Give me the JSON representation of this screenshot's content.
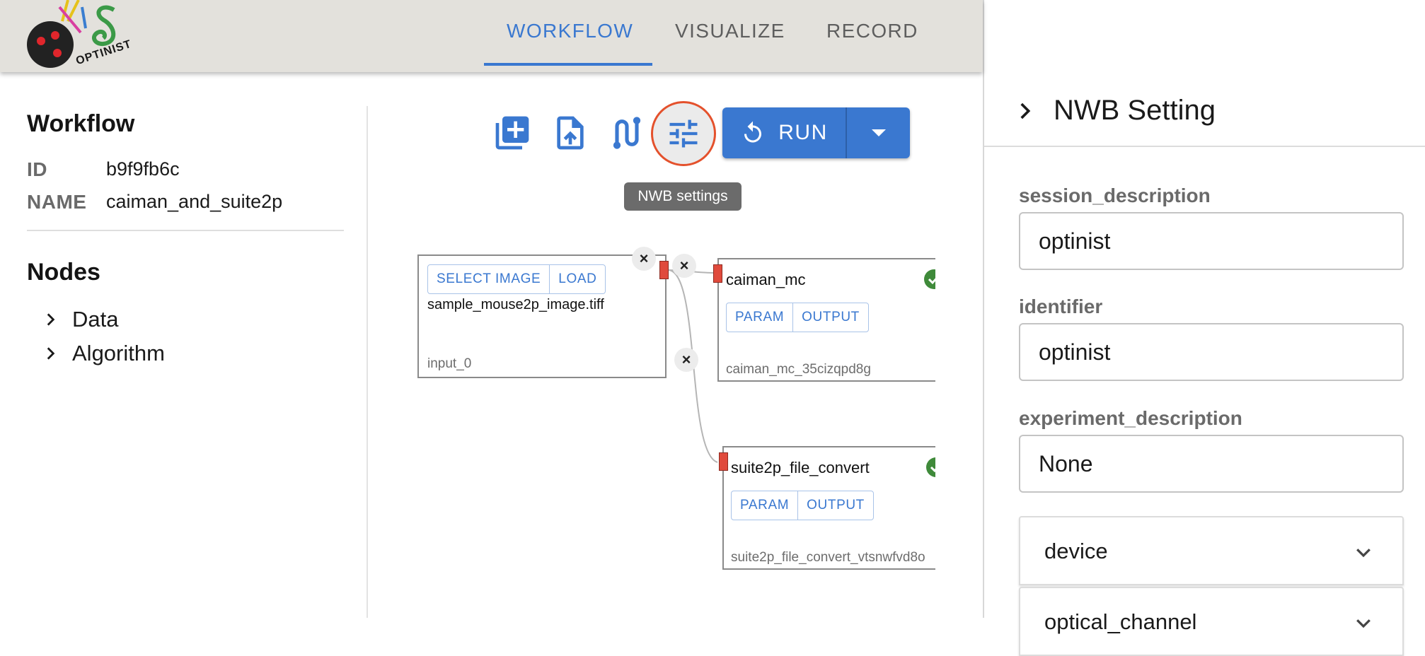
{
  "header": {
    "logo_text": "OPTINIST",
    "tabs": [
      {
        "label": "WORKFLOW",
        "active": true
      },
      {
        "label": "VISUALIZE",
        "active": false
      },
      {
        "label": "RECORD",
        "active": false
      }
    ]
  },
  "sidebar": {
    "workflow_heading": "Workflow",
    "id_label": "ID",
    "id_value": "b9f9fb6c",
    "name_label": "NAME",
    "name_value": "caiman_and_suite2p",
    "nodes_heading": "Nodes",
    "tree": [
      {
        "label": "Data"
      },
      {
        "label": "Algorithm"
      }
    ]
  },
  "toolbar": {
    "icons": [
      "add-library-icon",
      "upload-file-icon",
      "route-icon",
      "tune-sliders-icon"
    ],
    "run_label": "RUN",
    "tooltip": "NWB settings",
    "accent_color": "#3a78d0",
    "highlight_color": "#e4512c"
  },
  "flow": {
    "input_node": {
      "select_label": "SELECT IMAGE",
      "load_label": "LOAD",
      "file_name": "sample_mouse2p_image.tiff",
      "node_id": "input_0"
    },
    "algo_nodes": [
      {
        "title": "caiman_mc",
        "param_label": "PARAM",
        "output_label": "OUTPUT",
        "node_id": "caiman_mc_35cizqpd8g"
      },
      {
        "title": "suite2p_file_convert",
        "param_label": "PARAM",
        "output_label": "OUTPUT",
        "node_id": "suite2p_file_convert_vtsnwfvd8o"
      }
    ],
    "close_glyph": "×",
    "handle_color": "#e04a3c",
    "success_color": "#3f8a3a"
  },
  "nwb_panel": {
    "title": "NWB Setting",
    "fields": [
      {
        "label": "session_description",
        "value": "optinist"
      },
      {
        "label": "identifier",
        "value": "optinist"
      },
      {
        "label": "experiment_description",
        "value": "None"
      }
    ],
    "accordions": [
      {
        "label": "device"
      },
      {
        "label": "optical_channel"
      }
    ]
  }
}
